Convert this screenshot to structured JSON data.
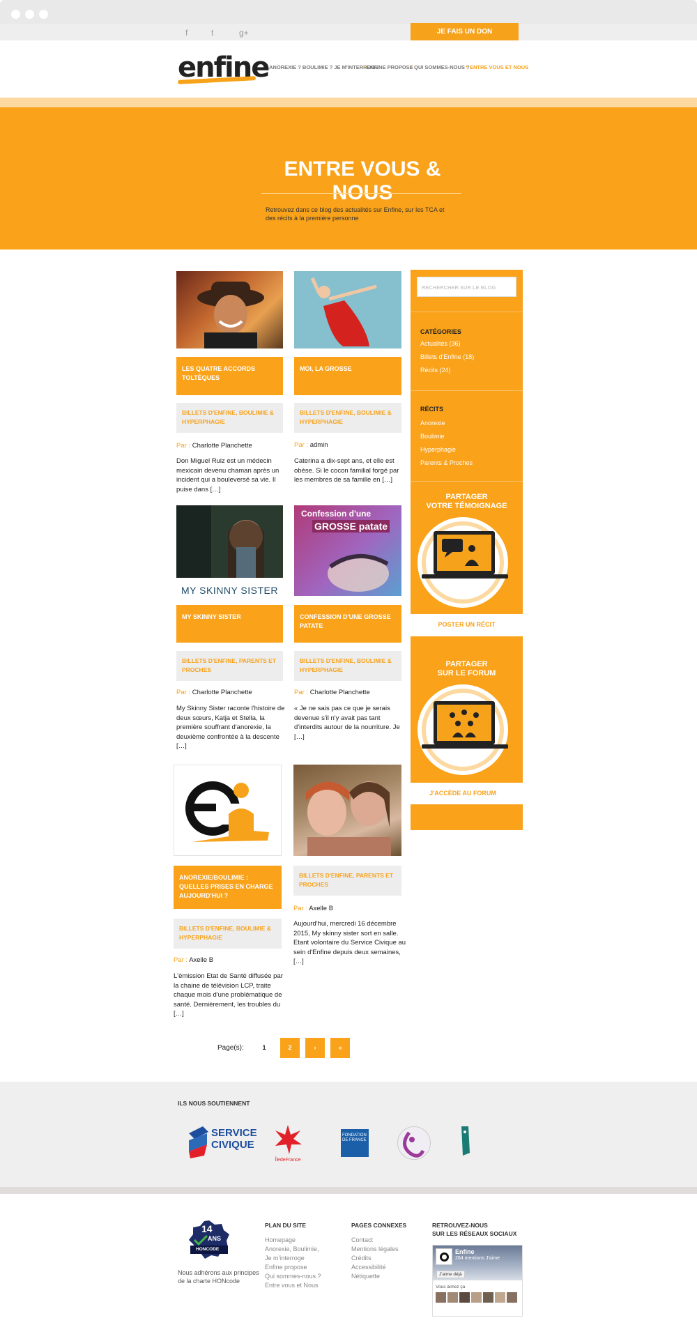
{
  "header": {
    "donate_label": "JE FAIS UN DON",
    "social": [
      "f",
      "t",
      "g+"
    ],
    "logo_text": "enfine",
    "nav": [
      {
        "label": "ANOREXIE ? BOULIMIE ? JE M'INTERROGE"
      },
      {
        "label": "ENFINE PROPOSE"
      },
      {
        "label": "QUI SOMMES-NOUS ?"
      },
      {
        "label": "ENTRE VOUS ET NOUS"
      }
    ]
  },
  "hero": {
    "title": "ENTRE VOUS & NOUS",
    "description": "Retrouvez dans ce blog des actualités sur Enfine, sur les TCA et des récits à la première personne"
  },
  "posts": [
    {
      "title": "LES QUATRE ACCORDS TOLTÈQUES",
      "category": "BILLETS D'ENFINE, BOULIMIE & HYPERPHAGIE",
      "par": "Par :",
      "author": "Charlotte Planchette",
      "excerpt": "Don Miguel Ruiz est un médecin mexicain devenu chaman après un incident qui a bouleversé sa vie. Il puise dans […]"
    },
    {
      "title": "MOI, LA GROSSE",
      "category": "BILLETS D'ENFINE, BOULIMIE & HYPERPHAGIE",
      "par": "Par :",
      "author": "admin",
      "excerpt": "Caterina a dix-sept ans, et elle est obèse. Si le cocon familial forgé par les membres de sa famille en […]"
    },
    {
      "title": "MY SKINNY SISTER",
      "category": "BILLETS D'ENFINE, PARENTS ET PROCHES",
      "par": "Par :",
      "author": "Charlotte Planchette",
      "excerpt": "My Skinny Sister raconte l'histoire de deux sœurs, Katja et Stella, la première souffrant d'anorexie, la deuxième confrontée à la descente […]",
      "poster_text": "MY SKINNY SISTER"
    },
    {
      "title": "CONFESSION D'UNE GROSSE PATATE",
      "category": "BILLETS D'ENFINE, BOULIMIE & HYPERPHAGIE",
      "par": "Par :",
      "author": "Charlotte Planchette",
      "excerpt": "« Je ne sais pas ce que je serais devenue s'il n'y avait pas tant d'interdits autour de la nourriture. Je […]",
      "poster_line1": "Confession d'une",
      "poster_line2": "GROSSE patate"
    },
    {
      "title": "ANOREXIE/BOULIMIE : QUELLES PRISES EN CHARGE AUJOURD'HUI ?",
      "category": "BILLETS D'ENFINE, BOULIMIE & HYPERPHAGIE",
      "par": "Par :",
      "author": "Axelle B",
      "excerpt": "L'émission Etat de Santé diffusée par la chaine de télévision LCP, traite chaque mois d'une problématique de santé. Dernièrement, les troubles du […]"
    },
    {
      "category": "BILLETS D'ENFINE, PARENTS ET PROCHES",
      "par": "Par :",
      "author": "Axelle B",
      "excerpt": "Aujourd'hui, mercredi 16 décembre 2015, My skinny sister sort en salle. Etant volontaire du Service Civique au sein d'Enfine depuis deux semaines, […]"
    }
  ],
  "sidebar": {
    "search_placeholder": "RECHERCHER SUR LE BLOG",
    "categories_heading": "CATÉGORIES",
    "categories": [
      "Actualités (36)",
      "Billets d'Enfine (18)",
      "Récits (24)"
    ],
    "recits_heading": "RÉCITS",
    "recits": [
      "Anorexie",
      "Boulimie",
      "Hyperphagie",
      "Parents & Proches"
    ],
    "share1_line1": "PARTAGER",
    "share1_line2": "VOTRE TÉMOIGNAGE",
    "share1_button": "POSTER UN RÉCIT",
    "share2_line1": "PARTAGER",
    "share2_line2": "SUR LE FORUM",
    "share2_button": "J'ACCÈDE AU FORUM"
  },
  "pagination": {
    "label": "Page(s):",
    "pages": [
      "1",
      "2",
      "›",
      "»"
    ]
  },
  "sponsors": {
    "heading": "ILS NOUS SOUTIENNENT",
    "service_civique_1": "SERVICE",
    "service_civique_2": "CIVIQUE",
    "iledefrance": "ÎledeFrance",
    "fondation": "FONDATION DE FRANCE"
  },
  "footer": {
    "badge_top": "14",
    "badge_mid": "ANS",
    "badge_bottom": "HONCODE",
    "honcode_text": "Nous adhérons aux principes de la charte HONcode",
    "plan_heading": "PLAN DU SITE",
    "plan_links": [
      "Homepage",
      "Anorexie, Boulimie,",
      "Je m'interroge",
      "Enfine propose",
      "Qui sommes-nous ?",
      "Entre vous et Nous"
    ],
    "pages_heading": "PAGES CONNEXES",
    "pages_links": [
      "Contact",
      "Mentions légales",
      "Crédits",
      "Accessibilité",
      "Nétiquette"
    ],
    "social_heading_1": "RETROUVEZ-NOUS",
    "social_heading_2": "SUR LES RÉSEAUX SOCIAUX",
    "fb_name": "Enfine",
    "fb_likes": "264 mentions J'aime",
    "fb_like_btn": "J'aime déjà",
    "fb_friends": "Vous aimez ça"
  },
  "colors": {
    "accent": "#f9a21a",
    "light": "#fcd9a0",
    "text": "#222222"
  }
}
